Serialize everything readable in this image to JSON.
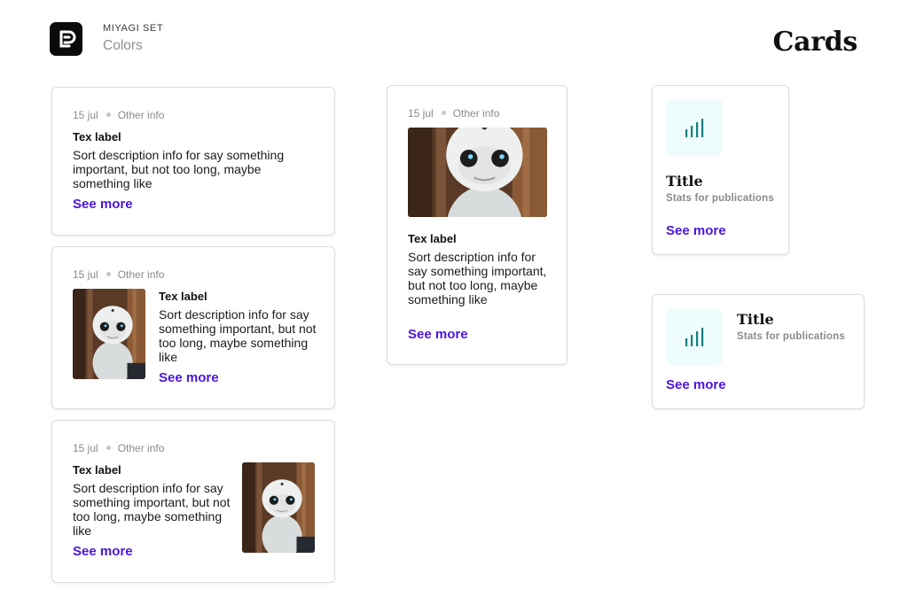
{
  "header": {
    "brand": "MIYAGI SET",
    "section": "Colors",
    "page_title": "Cards",
    "logo_glyph": "ʚ"
  },
  "colors": {
    "link": "#4b16e0",
    "stat_bg": "#eefcfd",
    "stat_icon": "#14807e"
  },
  "card1": {
    "date": "15 jul",
    "info": "Other info",
    "label": "Tex label",
    "desc": "Sort description info for say something important, but not too long, maybe something like",
    "more": "See more"
  },
  "card2": {
    "date": "15 jul",
    "info": "Other info",
    "label": "Tex label",
    "desc": "Sort description info for say something important, but not too long, maybe something like",
    "more": "See more"
  },
  "card3": {
    "date": "15 jul",
    "info": "Other info",
    "label": "Tex label",
    "desc": "Sort description info for say something important, but not too long, maybe something like",
    "more": "See more"
  },
  "card4": {
    "date": "15 jul",
    "info": "Other info",
    "label": "Tex label",
    "desc": "Sort description info for say something important, but not too long, maybe something like",
    "more": "See more"
  },
  "stat1": {
    "title": "Title",
    "subtitle": "Stats for publications",
    "more": "See more",
    "icon": "signal-bars-icon"
  },
  "stat2": {
    "title": "Title",
    "subtitle": "Stats for publications",
    "more": "See more",
    "icon": "signal-bars-icon"
  }
}
